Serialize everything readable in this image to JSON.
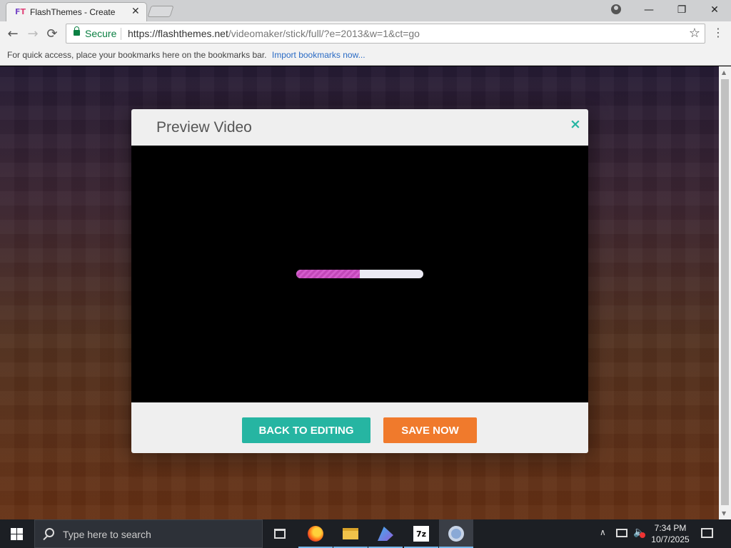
{
  "browser": {
    "tab_title": "FlashThemes - Create",
    "favicon_text": "FT",
    "tab_close": "✕",
    "url_host": "https://flashthemes.net",
    "url_path": "/videomaker/stick/full/?e=2013&w=1&ct=go",
    "secure_label": "Secure",
    "bookmarks_prompt": "For quick access, place your bookmarks here on the bookmarks bar.",
    "bookmarks_link": "Import bookmarks now...",
    "icons": {
      "back": "←",
      "forward": "→",
      "reload": "⟳",
      "star": "☆",
      "menu": "⋮",
      "minimize": "—",
      "maximize": "❐",
      "close": "✕"
    }
  },
  "modal": {
    "title": "Preview Video",
    "close": "×",
    "progress_fraction": 0.5,
    "back_button": "BACK TO EDITING",
    "save_button": "SAVE NOW"
  },
  "taskbar": {
    "search_placeholder": "Type here to search",
    "time": "7:34 PM",
    "date": "10/7/2025",
    "zip_label": "7z",
    "tray_caret": "∧",
    "volume": "🔈"
  },
  "colors": {
    "accent_teal": "#26b5a2",
    "accent_orange": "#f07a2c",
    "progress_pink": "#c247b8",
    "secure_green": "#0b8043"
  }
}
